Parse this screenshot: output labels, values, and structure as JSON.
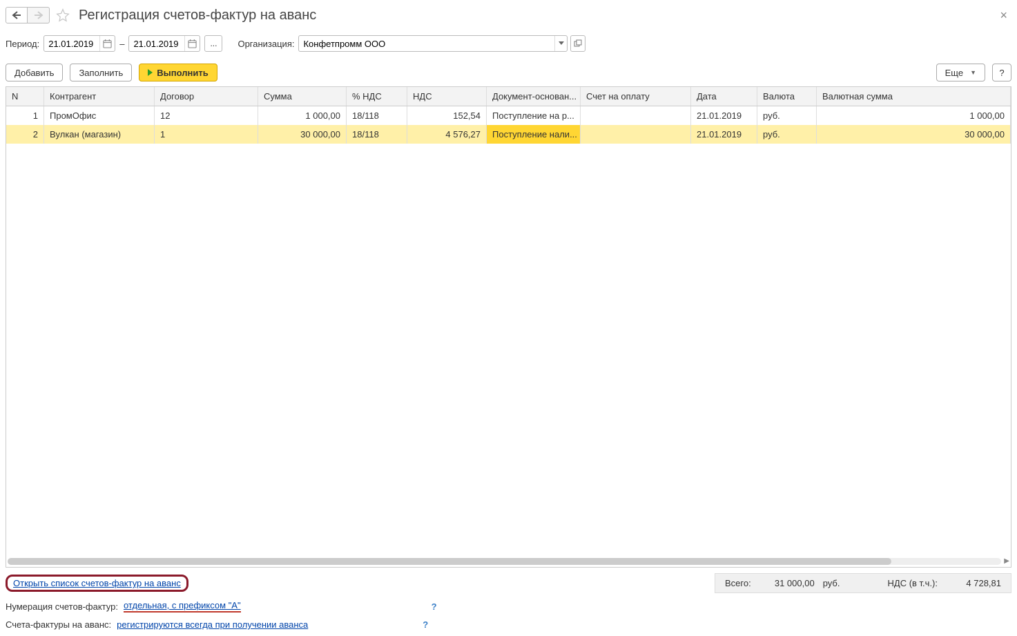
{
  "header": {
    "title": "Регистрация счетов-фактур на аванс"
  },
  "filter": {
    "period_label": "Период:",
    "date_from": "21.01.2019",
    "date_sep": "–",
    "date_to": "21.01.2019",
    "dots": "...",
    "org_label": "Организация:",
    "org_value": "Конфетпромм ООО"
  },
  "toolbar": {
    "add": "Добавить",
    "fill": "Заполнить",
    "run": "Выполнить",
    "more": "Еще",
    "help": "?"
  },
  "columns": {
    "n": "N",
    "ka": "Контрагент",
    "dg": "Договор",
    "sum": "Сумма",
    "ndsp": "% НДС",
    "nds": "НДС",
    "doc": "Документ-основан...",
    "scht": "Счет на оплату",
    "date": "Дата",
    "val": "Валюта",
    "vs": "Валютная сумма"
  },
  "rows": [
    {
      "n": "1",
      "ka": "ПромОфис",
      "dg": "12",
      "sum": "1 000,00",
      "ndsp": "18/118",
      "nds": "152,54",
      "doc": "Поступление на р...",
      "scht": "",
      "date": "21.01.2019",
      "val": "руб.",
      "vs": "1 000,00"
    },
    {
      "n": "2",
      "ka": "Вулкан (магазин)",
      "dg": "1",
      "sum": "30 000,00",
      "ndsp": "18/118",
      "nds": "4 576,27",
      "doc": "Поступление нали...",
      "scht": "",
      "date": "21.01.2019",
      "val": "руб.",
      "vs": "30 000,00"
    }
  ],
  "footer": {
    "open_list": "Открыть список счетов-фактур на аванс",
    "num_label": "Нумерация счетов-фактур:",
    "num_link": "отдельная, с префиксом \"А\"",
    "sf_label": "Счета-фактуры на аванс:",
    "sf_link": "регистрируются всегда при получении аванса",
    "q": "?",
    "totals": {
      "all_label": "Всего:",
      "all_value": "31 000,00",
      "all_currency": "руб.",
      "nds_label": "НДС (в т.ч.):",
      "nds_value": "4 728,81"
    }
  }
}
